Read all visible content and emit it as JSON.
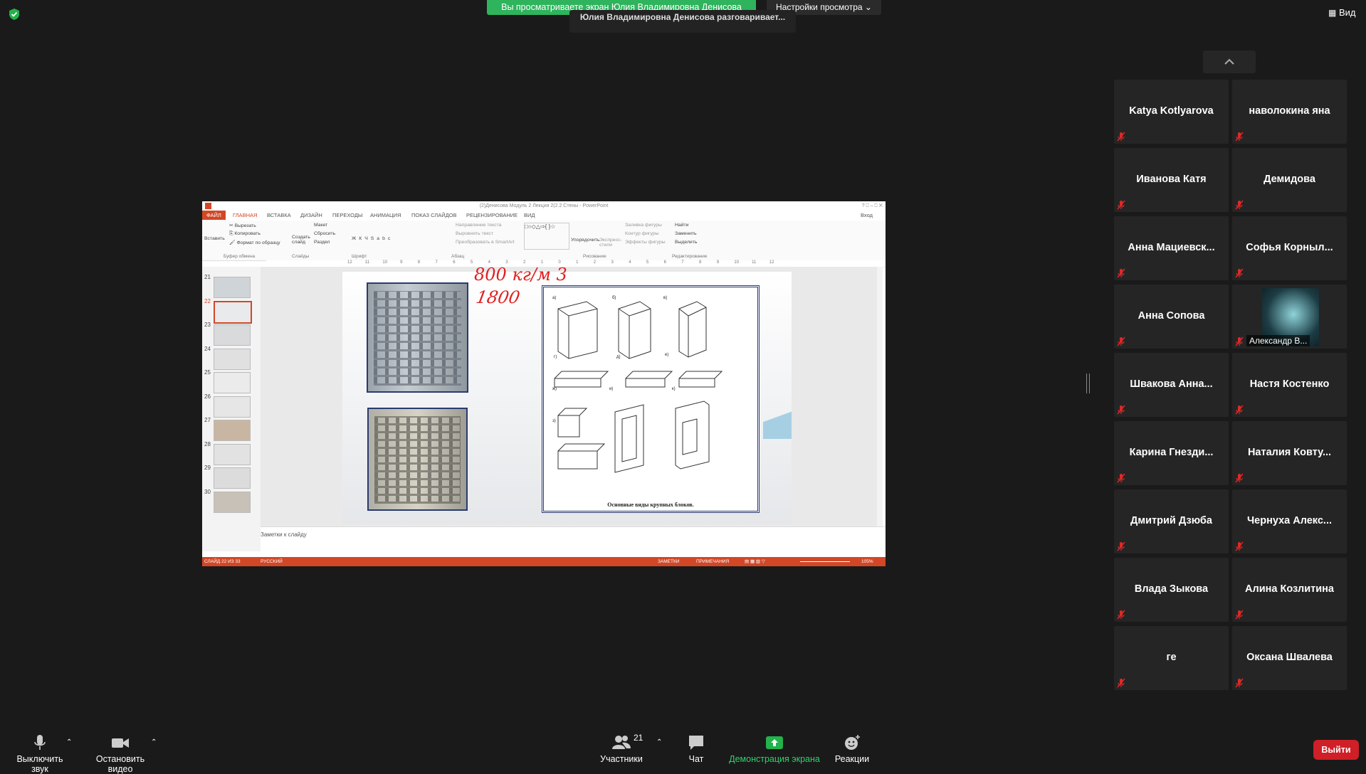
{
  "banner": {
    "sharing_text": "Вы просматриваете экран Юлия Владимировна Денисова",
    "view_settings": "Настройки просмотра",
    "talking": "Юлия Владимировна Денисова разговаривает..."
  },
  "view_label": "Вид",
  "ppt": {
    "title": "(2)Денисова Модуль 2 Лекция 2(2.2 Стены - PowerPoint",
    "tabs": [
      "ФАЙЛ",
      "ГЛАВНАЯ",
      "ВСТАВКА",
      "ДИЗАЙН",
      "ПЕРЕХОДЫ",
      "АНИМАЦИЯ",
      "ПОКАЗ СЛАЙДОВ",
      "РЕЦЕНЗИРОВАНИЕ",
      "ВИД"
    ],
    "signin": "Вход",
    "ribbon": {
      "paste": "Вставить",
      "cut": "Вырезать",
      "copy": "Копировать",
      "format_painter": "Формат по образцу",
      "new_slide": "Создать слайд",
      "layout": "Макет",
      "reset": "Сбросить",
      "section": "Раздел",
      "text_direction": "Направление текста",
      "align_text": "Выровнять текст",
      "smartart": "Преобразовать в SmartArt",
      "arrange": "Упорядочить",
      "quick_styles": "Экспресс-стили",
      "shape_fill": "Заливка фигуры",
      "shape_outline": "Контур фигуры",
      "shape_effects": "Эффекты фигуры",
      "find": "Найти",
      "replace": "Заменить",
      "select": "Выделить",
      "groups": [
        "Буфер обмена",
        "Слайды",
        "Шрифт",
        "Абзац",
        "Рисование",
        "Редактирование"
      ]
    },
    "ruler_marks": [
      "12",
      "11",
      "10",
      "9",
      "8",
      "7",
      "6",
      "5",
      "4",
      "3",
      "2",
      "1",
      "0",
      "1",
      "2",
      "3",
      "4",
      "5",
      "6",
      "7",
      "8",
      "9",
      "10",
      "11",
      "12"
    ],
    "thumb_numbers": [
      "21",
      "22",
      "23",
      "24",
      "25",
      "26",
      "27",
      "28",
      "29",
      "30"
    ],
    "slide": {
      "handwriting_1": "800 кг/м 3",
      "handwriting_2": "1800",
      "figure_caption": "Основные виды крупных блоков.",
      "diagram_labels": [
        "а)",
        "б)",
        "в)",
        "г)",
        "д)",
        "е)",
        "ж)",
        "з)",
        "и)",
        "к)"
      ]
    },
    "notes_placeholder": "Заметки к слайду",
    "status": {
      "slide_counter": "СЛАЙД 22 ИЗ 33",
      "language": "РУССКИЙ",
      "notes": "ЗАМЕТКИ",
      "comments": "ПРИМЕЧАНИЯ",
      "zoom": "105%"
    }
  },
  "participants": [
    {
      "name": "Katya Kotlyarova"
    },
    {
      "name": "наволокина яна"
    },
    {
      "name": "Иванова Катя"
    },
    {
      "name": "Демидова"
    },
    {
      "name": "Анна  Мациевск..."
    },
    {
      "name": "Софья  Корныл..."
    },
    {
      "name": "Анна Сопова"
    },
    {
      "name": "Александр В..."
    },
    {
      "name": "Швакова  Анна..."
    },
    {
      "name": "Настя Костенко"
    },
    {
      "name": "Карина  Гнезди..."
    },
    {
      "name": "Наталия  Ковту..."
    },
    {
      "name": "Дмитрий Дзюба"
    },
    {
      "name": "Чернуха  Алекс..."
    },
    {
      "name": "Влада Зыкова"
    },
    {
      "name": "Алина Козлитина"
    },
    {
      "name": "ге"
    },
    {
      "name": "Оксана Швалева"
    }
  ],
  "toolbar": {
    "mute": "Выключить звук",
    "stop_video": "Остановить видео",
    "participants": "Участники",
    "participants_count": "21",
    "chat": "Чат",
    "share": "Демонстрация экрана",
    "reactions": "Реакции",
    "leave": "Выйти"
  },
  "colors": {
    "share_green": "#2fb35d",
    "ppt_orange": "#d24726",
    "leave_red": "#cf1f27",
    "mute_red": "#e02828"
  }
}
